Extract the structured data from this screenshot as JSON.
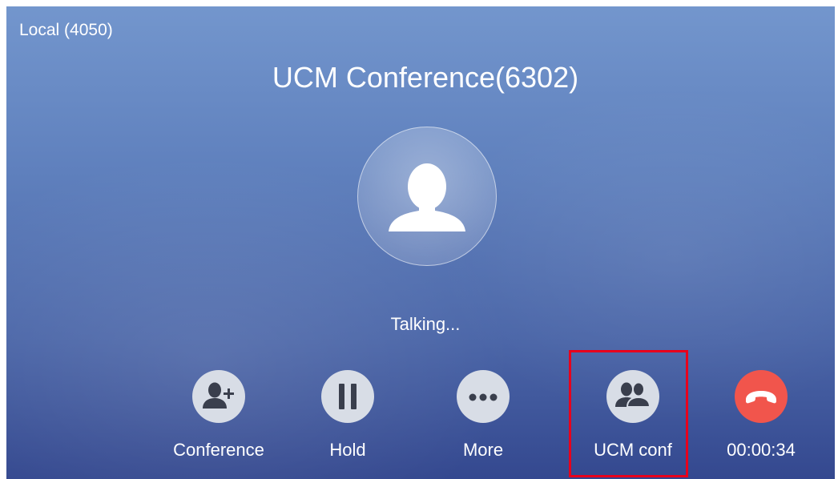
{
  "call": {
    "line_label": "Local (4050)",
    "remote_name": "UCM Conference(6302)",
    "status": "Talking..."
  },
  "avatar": {
    "icon": "person-silhouette-icon"
  },
  "actions": [
    {
      "id": "conference",
      "label": "Conference",
      "icon": "add-person-icon"
    },
    {
      "id": "hold",
      "label": "Hold",
      "icon": "pause-icon"
    },
    {
      "id": "more",
      "label": "More",
      "icon": "ellipsis-icon"
    },
    {
      "id": "ucm_conf",
      "label": "UCM conf",
      "icon": "group-icon",
      "highlighted": true
    },
    {
      "id": "hangup",
      "label": "00:00:34",
      "icon": "hang-up-icon",
      "label_is_call_duration": true
    }
  ],
  "colors": {
    "action_button_bg": "#d8dde6",
    "action_icon": "#3a3f4d",
    "hangup_bg": "#f1554c",
    "highlight_border": "#e8001c",
    "text": "#ffffff"
  }
}
